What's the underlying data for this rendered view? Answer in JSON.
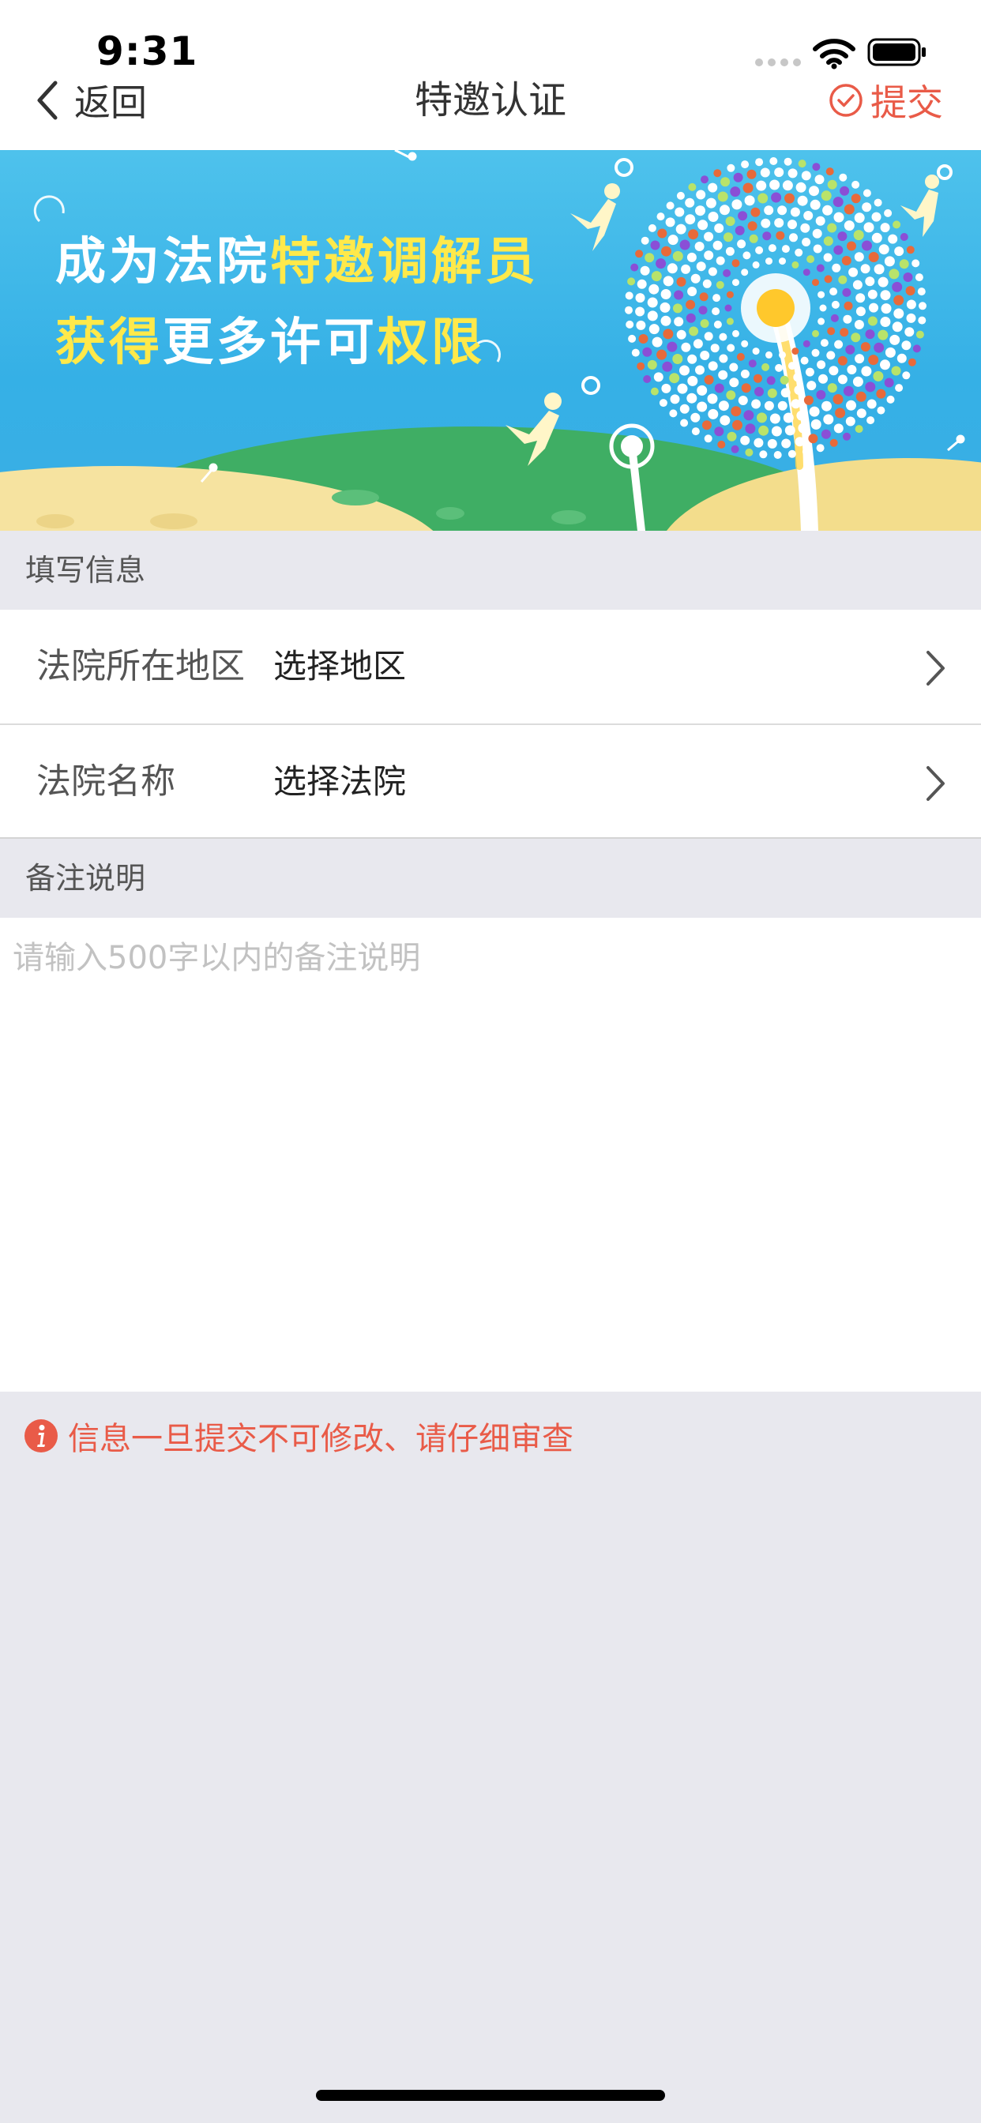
{
  "status_bar": {
    "time": "9:31"
  },
  "nav": {
    "back_label": "返回",
    "title": "特邀认证",
    "submit_label": "提交"
  },
  "banner": {
    "line1_part1": "成为法院",
    "line1_part2": "特邀调解员",
    "line2_part1": "获得",
    "line2_part2": "更多许可",
    "line2_part3": "权限"
  },
  "form": {
    "section_title": "填写信息",
    "region": {
      "label": "法院所在地区",
      "value": "选择地区"
    },
    "court": {
      "label": "法院名称",
      "value": "选择法院"
    }
  },
  "remark": {
    "section_title": "备注说明",
    "placeholder": "请输入500字以内的备注说明",
    "value": ""
  },
  "warning": {
    "text": "信息一旦提交不可修改、请仔细审查"
  },
  "colors": {
    "accent": "#e95b48",
    "banner_blue": "#3aaee4",
    "banner_yellow": "#ffe94a",
    "background": "#e8e8ee"
  },
  "icons": {
    "back": "chevron-left-icon",
    "submit": "check-circle-icon",
    "row_arrow": "chevron-right-icon",
    "warning": "info-circle-icon"
  }
}
